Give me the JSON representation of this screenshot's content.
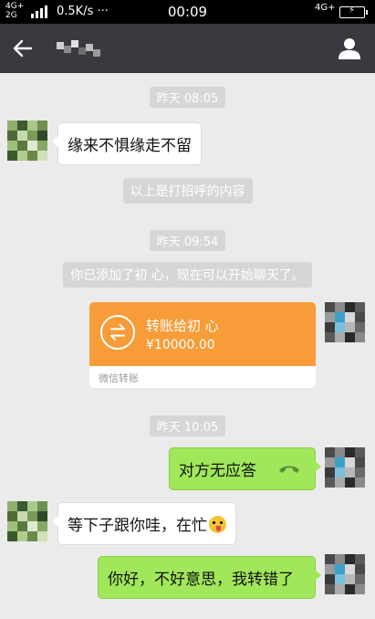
{
  "status_bar": {
    "network_left_top": "4G+",
    "network_left_bottom": "2G",
    "speed": "0.5K/s ···",
    "time": "00:09",
    "network_right": "4G+"
  },
  "chat": {
    "messages": [
      {
        "type": "time",
        "text": "昨天 08:05"
      },
      {
        "type": "incoming",
        "text": "缘来不惧缘走不留"
      },
      {
        "type": "system",
        "text": "以上是打招呼的内容"
      },
      {
        "type": "time",
        "text": "昨天 09:54"
      },
      {
        "type": "system",
        "text": "你已添加了初 心，现在可以开始聊天了。"
      },
      {
        "type": "transfer",
        "title": "转账给初 心",
        "amount": "¥10000.00",
        "footer": "微信转账"
      },
      {
        "type": "time",
        "text": "昨天 10:05"
      },
      {
        "type": "call",
        "text": "对方无应答"
      },
      {
        "type": "incoming",
        "text": "等下子跟你哇，在忙"
      },
      {
        "type": "outgoing",
        "text": "你好，不好意思，我转错了"
      }
    ]
  },
  "icons": {
    "back": "arrow-left-icon",
    "profile": "person-icon",
    "transfer": "exchange-icon",
    "call": "phone-hangup-icon",
    "emoji": "tongue-wink-emoji"
  },
  "colors": {
    "nav_bar": "#393a3f",
    "background": "#ebebeb",
    "outgoing_bubble": "#a0e75a",
    "transfer_card": "#f79c38",
    "system_label": "#d6d6d6"
  }
}
